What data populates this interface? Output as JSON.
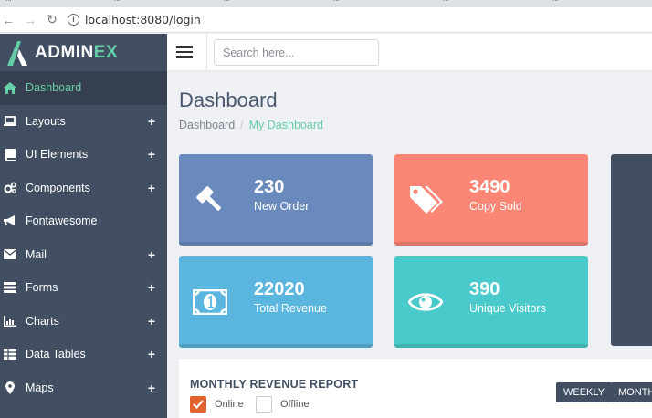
{
  "browser": {
    "tabs": [
      "...",
      "...",
      "...",
      "...",
      "...",
      "..."
    ],
    "url": "localhost:8080/login"
  },
  "brand": {
    "name_main": "ADMIN",
    "name_accent": "EX"
  },
  "sidebar": {
    "items": [
      {
        "label": "Dashboard",
        "icon": "home-icon",
        "has_plus": false
      },
      {
        "label": "Layouts",
        "icon": "laptop-icon",
        "has_plus": true
      },
      {
        "label": "UI Elements",
        "icon": "book-icon",
        "has_plus": true
      },
      {
        "label": "Components",
        "icon": "cogs-icon",
        "has_plus": true
      },
      {
        "label": "Fontawesome",
        "icon": "bullhorn-icon",
        "has_plus": false
      },
      {
        "label": "Mail",
        "icon": "envelope-icon",
        "has_plus": true
      },
      {
        "label": "Forms",
        "icon": "tasks-icon",
        "has_plus": true
      },
      {
        "label": "Charts",
        "icon": "bar-chart-icon",
        "has_plus": true
      },
      {
        "label": "Data Tables",
        "icon": "table-icon",
        "has_plus": true
      },
      {
        "label": "Maps",
        "icon": "map-marker-icon",
        "has_plus": true
      }
    ],
    "plus_symbol": "+"
  },
  "header": {
    "search_placeholder": "Search here..."
  },
  "page": {
    "title": "Dashboard",
    "breadcrumb": {
      "root": "Dashboard",
      "sep": "/",
      "current": "My Dashboard"
    }
  },
  "stats": [
    {
      "value": "230",
      "label": "New Order",
      "icon": "gavel-icon",
      "color": "#6a8abe"
    },
    {
      "value": "3490",
      "label": "Copy Sold",
      "icon": "tags-icon",
      "color": "#fc8675"
    },
    {
      "value": "22020",
      "label": "Total Revenue",
      "icon": "money-icon",
      "color": "#5ab6df"
    },
    {
      "value": "390",
      "label": "Unique Visitors",
      "icon": "eye-icon",
      "color": "#4acacb"
    }
  ],
  "report": {
    "title": "MONTHLY REVENUE REPORT",
    "online_label": "Online",
    "offline_label": "Offline",
    "online_checked": true,
    "offline_checked": false,
    "weekly_label": "WEEKLY",
    "monthly_label": "MONTH"
  },
  "colors": {
    "sidebar": "#424f63",
    "accent": "#65cea7",
    "checkbox": "#e2632c"
  }
}
